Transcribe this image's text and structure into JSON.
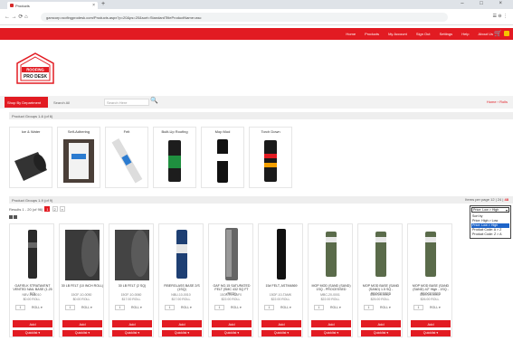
{
  "browser": {
    "tab_title": "Products",
    "url": "gamcorp.roofingprodesk.com/Products.aspx?p=20&ps=20&sort=StandardTitleProductName=asc",
    "tab_close": "×",
    "new_tab": "+",
    "window_controls": "–  □  ×",
    "nav_icons": "←  →  ⟳  ⌂",
    "right_icons": "☰  ⊖  ⋮"
  },
  "header": {
    "top_links": [
      "Home",
      "Products",
      "My Account",
      "Sign Out",
      "Settings",
      "Help",
      "About Us"
    ],
    "logo_line1": "ROOFING",
    "logo_line2": "PRO DESK"
  },
  "search": {
    "shop_by_department": "Shop By Department",
    "category_select": "Search All",
    "search_placeholder": "Search Here",
    "breadcrumb": "Home › Rolls"
  },
  "category_group": {
    "heading": "Product Groups 1-6 (of 6)",
    "items": [
      "Ice & Water",
      "Self-Adhering",
      "Felt",
      "Built-Up Roofing",
      "Mop Mod",
      "Torch Down"
    ]
  },
  "product_group": {
    "heading": "Product Groups 1-9 (of 9)",
    "results_label": "Results 1 - 20 (of 96)",
    "pages": [
      "1",
      "2",
      "»"
    ],
    "per_page_label": "Items per page",
    "per_page_options": [
      "12",
      "24",
      "48"
    ],
    "per_page_active": "48"
  },
  "sort_dropdown": {
    "selected": "Price: Low > High",
    "options": [
      "Sort by",
      "Price: High > Low",
      "Price: Low > High",
      "Product Code: A > Z",
      "Product Code: Z > A"
    ],
    "highlighted_index": 2
  },
  "products": [
    {
      "name": "GAF/ELK STRATAVENT VENTED NAIL BASE (1.25 SQ)",
      "sku": "NBV-16-0010",
      "price": "$0.00 ROLL",
      "qty": "1",
      "unit": "ROLL ▾",
      "add": "Add",
      "list": "Quicklist ▾"
    },
    {
      "name": "30 LB FELT (10 INCH ROLL)",
      "sku": "15OF-10-0050",
      "price": "$0.00 ROLL",
      "qty": "1",
      "unit": "ROLL ▾",
      "add": "Add",
      "list": "Quicklist ▾"
    },
    {
      "name": "30 LB FELT (2 SQ)",
      "sku": "15OF-10-0060",
      "price": "$17.00 ROLL",
      "qty": "1",
      "unit": "ROLL ▾",
      "add": "Add",
      "list": "Quicklist ▾"
    },
    {
      "name": "FIBERGLASS BASE 2/S (1SQ)",
      "sku": "NBU-10-0010",
      "price": "$17.00 ROLL",
      "qty": "1",
      "unit": "ROLL ▾",
      "add": "Add",
      "list": "Quicklist ▾"
    },
    {
      "name": "GAF NO.15 SATURATED FELT (SMC 432 SQ FT (RED))",
      "sku": "15OF-10-GAF0",
      "price": "$22.00 ROLL",
      "qty": "1",
      "unit": "ROLL ▾",
      "add": "Add",
      "list": "Quicklist ▾"
    },
    {
      "name": "15# FELT, ASTM4869",
      "sku": "15OF-10-TAMK",
      "price": "$22.00 ROLL",
      "qty": "1",
      "unit": "ROLL ▾",
      "add": "Add",
      "list": "Quicklist ▾"
    },
    {
      "name": "MOP MOD (SAND (SAND) 1SQ - PROCESSED",
      "sku": "MBC-20-0001",
      "price": "$22.00 ROLL",
      "qty": "1",
      "unit": "ROLL ▾",
      "add": "Add",
      "list": "Quicklist ▾"
    },
    {
      "name": "MOP MOD BASE (SAND (SAND) 1.5 SQ - PROCESSED",
      "sku": "MBC-20-0002",
      "price": "$25.00 ROLL",
      "qty": "1",
      "unit": "ROLL ▾",
      "add": "Add",
      "list": "Quicklist ▾"
    },
    {
      "name": "MOP MOD BASE (SAND (SAND) 42\" High - 1SQ - PROCESSED",
      "sku": "MBC-20-0003",
      "price": "$26.00 ROLL",
      "qty": "1",
      "unit": "ROLL ▾",
      "add": "Add",
      "list": "Quicklist ▾"
    }
  ]
}
